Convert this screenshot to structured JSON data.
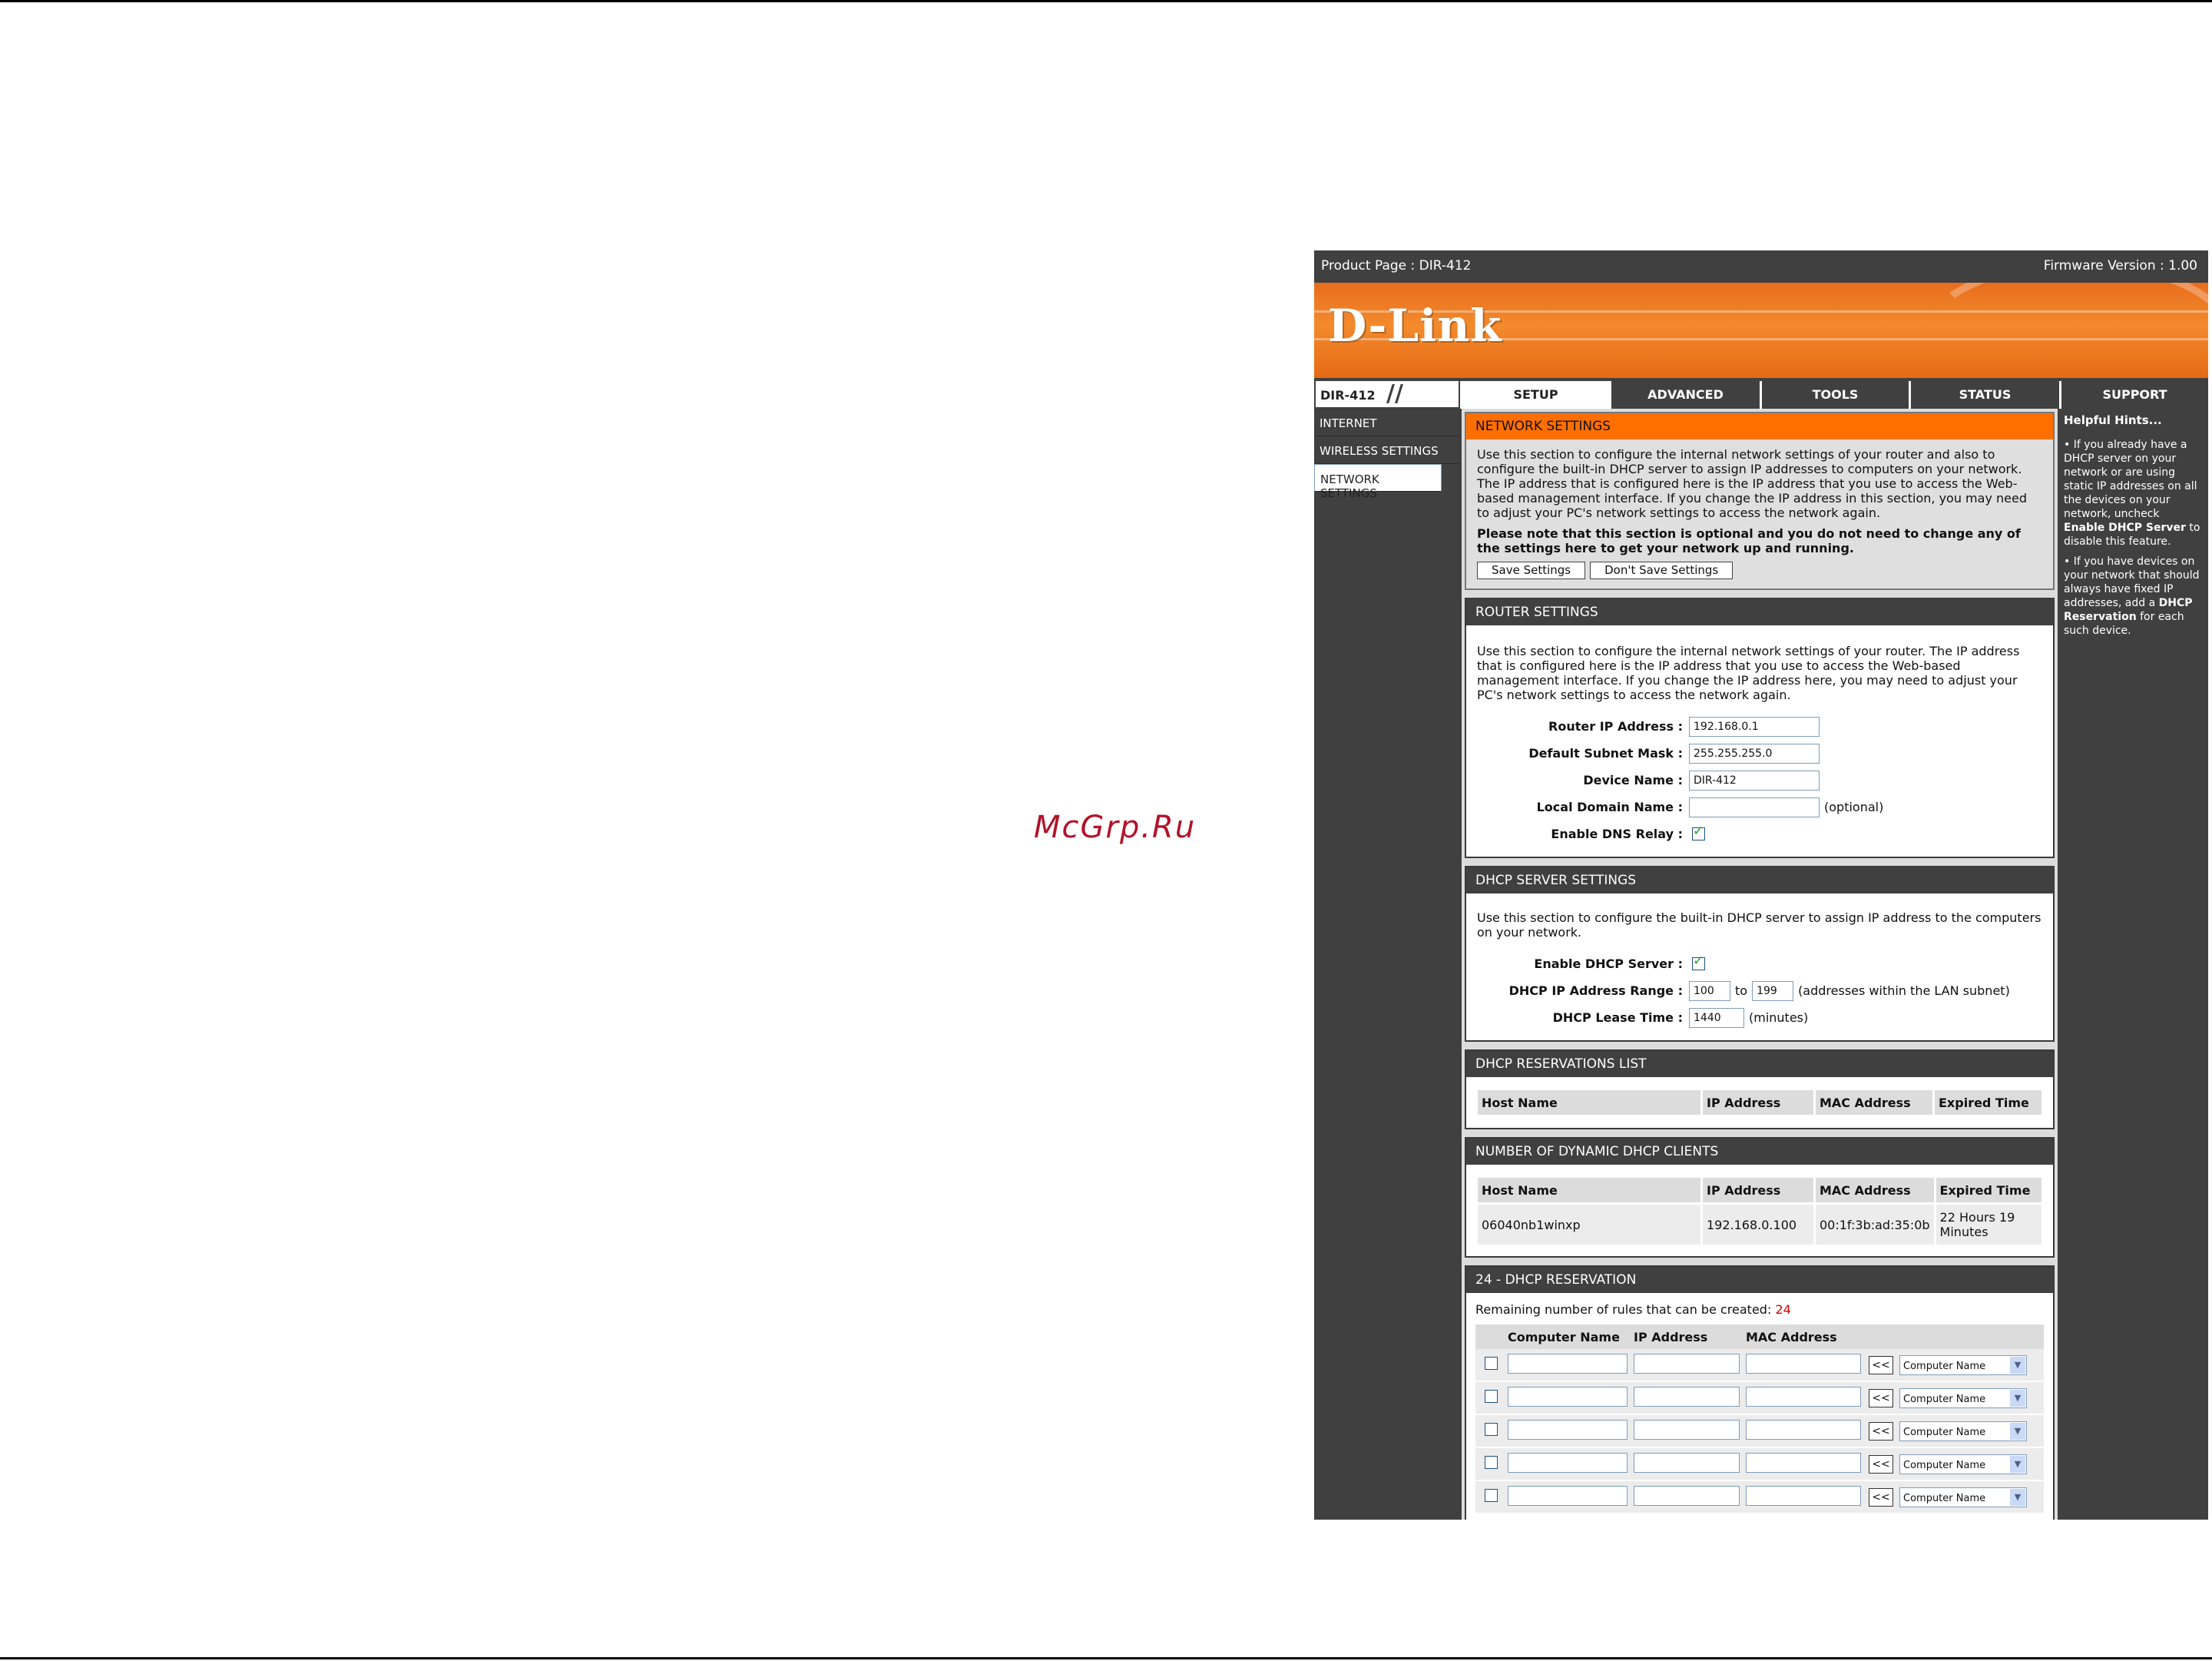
{
  "watermark": "McGrp.Ru",
  "topbar": {
    "product": "Product Page : DIR-412",
    "firmware": "Firmware Version : 1.00"
  },
  "logo": "D-Link",
  "model": "DIR-412",
  "tabs": [
    "SETUP",
    "ADVANCED",
    "TOOLS",
    "STATUS",
    "SUPPORT"
  ],
  "sidebar": [
    "INTERNET",
    "WIRELESS SETTINGS",
    "NETWORK SETTINGS"
  ],
  "network": {
    "title": "NETWORK SETTINGS",
    "desc": "Use this section to configure the internal network settings of your router and also to configure the built-in DHCP server to assign IP addresses to computers on your network. The IP address that is configured here is the IP address that you use to access the Web-based management interface. If you change the IP address in this section, you may need to adjust your PC's network settings to access the network again.",
    "note": "Please note that this section is optional and you do not need to change any of the settings here to get your network up and running.",
    "save": "Save Settings",
    "dontsave": "Don't Save Settings"
  },
  "router": {
    "title": "ROUTER SETTINGS",
    "desc": "Use this section to configure the internal network settings of your router. The IP address that is configured here is the IP address that you use to access the Web-based management interface. If you change the IP address here, you may need to adjust your PC's network settings to access the network again.",
    "ip_label": "Router IP Address :",
    "ip": "192.168.0.1",
    "mask_label": "Default Subnet Mask :",
    "mask": "255.255.255.0",
    "dev_label": "Device Name :",
    "dev": "DIR-412",
    "domain_label": "Local Domain Name :",
    "domain": "",
    "optional": "(optional)",
    "dns_label": "Enable DNS Relay :",
    "dns_checked": true
  },
  "dhcp": {
    "title": "DHCP SERVER SETTINGS",
    "desc": "Use this section to configure the built-in DHCP server to assign IP address to the computers on your network.",
    "enable_label": "Enable DHCP Server :",
    "range_label": "DHCP IP Address Range :",
    "range_from": "100",
    "to": "to",
    "range_to": "199",
    "range_note": "(addresses within the LAN subnet)",
    "lease_label": "DHCP Lease Time :",
    "lease": "1440",
    "lease_note": "(minutes)"
  },
  "reservations": {
    "title": "DHCP RESERVATIONS LIST",
    "cols": [
      "Host Name",
      "IP Address",
      "MAC Address",
      "Expired Time"
    ]
  },
  "clients": {
    "title": "NUMBER OF DYNAMIC DHCP CLIENTS",
    "cols": [
      "Host Name",
      "IP Address",
      "MAC Address",
      "Expired Time"
    ],
    "rows": [
      [
        "06040nb1winxp",
        "192.168.0.100",
        "00:1f:3b:ad:35:0b",
        "22 Hours 19 Minutes"
      ]
    ]
  },
  "res24": {
    "title": "24 - DHCP RESERVATION",
    "remaining_label": "Remaining number of rules that can be created:",
    "remaining": "24",
    "cols": [
      "Computer Name",
      "IP Address",
      "MAC Address"
    ],
    "arrow": "<<",
    "select": "Computer Name"
  },
  "hints": {
    "title": "Helpful Hints...",
    "h1a": "• If you already have a DHCP server on your network or are using static IP addresses on all the devices on your network, uncheck ",
    "h1b": "Enable DHCP Server",
    "h1c": " to disable this feature.",
    "h2a": "• If you have devices on your network that should always have fixed IP addresses, add a ",
    "h2b": "DHCP Reservation",
    "h2c": " for each such device."
  }
}
